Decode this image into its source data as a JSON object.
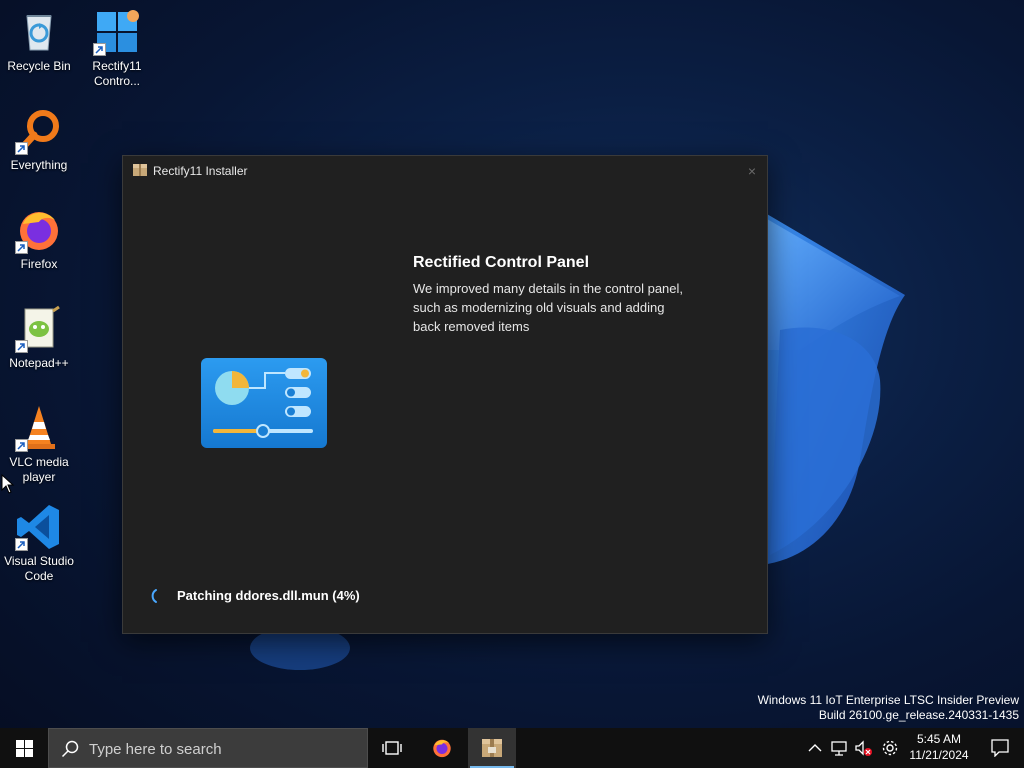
{
  "desktop": {
    "icons": [
      {
        "label": "Recycle Bin"
      },
      {
        "label": "Rectify11 Contro..."
      },
      {
        "label": "Everything"
      },
      {
        "label": "Firefox"
      },
      {
        "label": "Notepad++"
      },
      {
        "label": "VLC media player"
      },
      {
        "label": "Visual Studio Code"
      }
    ]
  },
  "installer": {
    "title": "Rectify11 Installer",
    "close_symbol": "×",
    "heading": "Rectified Control Panel",
    "description": "We improved many details in the control panel, such as modernizing old visuals and adding back removed items",
    "status": "Patching ddores.dll.mun (4%)"
  },
  "watermark": {
    "line1": "Windows 11 IoT Enterprise LTSC Insider Preview",
    "line2": "Build 26100.ge_release.240331-1435"
  },
  "taskbar": {
    "search_placeholder": "Type here to search",
    "clock": {
      "time": "5:45 AM",
      "date": "11/21/2024"
    }
  },
  "colors": {
    "window_bg": "#202020",
    "taskbar_bg": "#101010",
    "accent": "#0078d4",
    "panel_art_bg": "#1f8fe0"
  }
}
